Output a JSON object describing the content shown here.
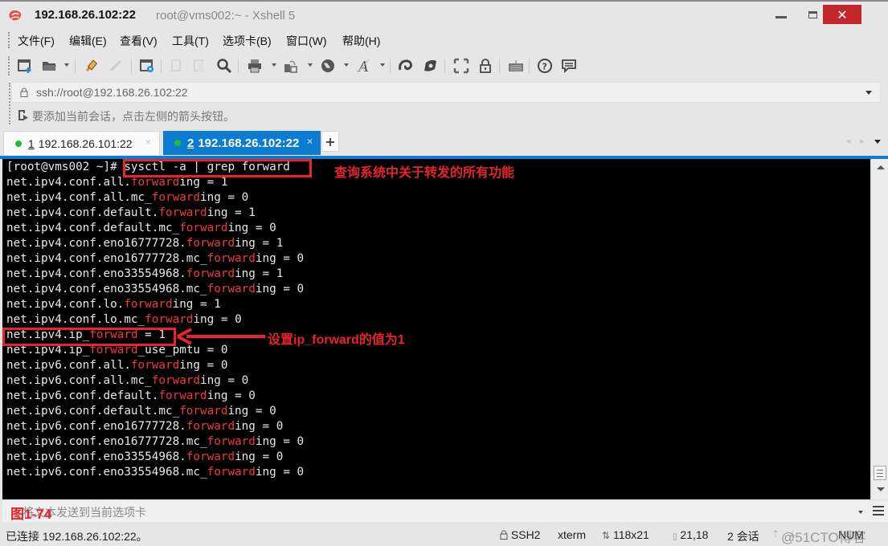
{
  "window": {
    "title_host": "192.168.26.102:22",
    "title_sub": "root@vms002:~ - Xshell 5",
    "close_glyph": "✕"
  },
  "menu": {
    "items": [
      {
        "label": "文件(F)"
      },
      {
        "label": "编辑(E)"
      },
      {
        "label": "查看(V)"
      },
      {
        "label": "工具(T)"
      },
      {
        "label": "选项卡(B)"
      },
      {
        "label": "窗口(W)"
      },
      {
        "label": "帮助(H)"
      }
    ]
  },
  "toolbar": {
    "icons": [
      "new-session-icon",
      "open-folder-icon",
      "connect-icon",
      "disconnect-icon",
      "session-properties-icon",
      "copy-icon",
      "paste-icon",
      "find-icon",
      "print-icon",
      "transfer-icon",
      "globe-icon",
      "font-icon",
      "xftp-icon",
      "xmanager-icon",
      "fullscreen-icon",
      "lock-icon",
      "keyboard-icon",
      "help-icon",
      "chat-icon"
    ]
  },
  "address": {
    "value": "ssh://root@192.168.26.102:22"
  },
  "hint": {
    "text": "要添加当前会话，点击左侧的箭头按钮。"
  },
  "tabs": [
    {
      "num": "1",
      "label": "192.168.26.101:22",
      "status_color": "#1fbf2c",
      "active": false
    },
    {
      "num": "2",
      "label": "192.168.26.102:22",
      "status_color": "#1fbf2c",
      "active": true
    }
  ],
  "tab_add_label": "+",
  "tab_close_glyph": "×",
  "tab_nav": "◂ ▸",
  "terminal": {
    "lines": [
      {
        "pre": "[root@vms002 ~]# sysctl -a | grep forward",
        "hl": "",
        "post": ""
      },
      {
        "pre": "net.ipv4.conf.all.",
        "hl": "forward",
        "post": "ing = 1"
      },
      {
        "pre": "net.ipv4.conf.all.mc_",
        "hl": "forward",
        "post": "ing = 0"
      },
      {
        "pre": "net.ipv4.conf.default.",
        "hl": "forward",
        "post": "ing = 1"
      },
      {
        "pre": "net.ipv4.conf.default.mc_",
        "hl": "forward",
        "post": "ing = 0"
      },
      {
        "pre": "net.ipv4.conf.eno16777728.",
        "hl": "forward",
        "post": "ing = 1"
      },
      {
        "pre": "net.ipv4.conf.eno16777728.mc_",
        "hl": "forward",
        "post": "ing = 0"
      },
      {
        "pre": "net.ipv4.conf.eno33554968.",
        "hl": "forward",
        "post": "ing = 1"
      },
      {
        "pre": "net.ipv4.conf.eno33554968.mc_",
        "hl": "forward",
        "post": "ing = 0"
      },
      {
        "pre": "net.ipv4.conf.lo.",
        "hl": "forward",
        "post": "ing = 1"
      },
      {
        "pre": "net.ipv4.conf.lo.mc_",
        "hl": "forward",
        "post": "ing = 0"
      },
      {
        "pre": "net.ipv4.ip_",
        "hl": "forward",
        "post": " = 1"
      },
      {
        "pre": "net.ipv4.ip_",
        "hl": "forward",
        "post": "_use_pmtu = 0"
      },
      {
        "pre": "net.ipv6.conf.all.",
        "hl": "forward",
        "post": "ing = 0"
      },
      {
        "pre": "net.ipv6.conf.all.mc_",
        "hl": "forward",
        "post": "ing = 0"
      },
      {
        "pre": "net.ipv6.conf.default.",
        "hl": "forward",
        "post": "ing = 0"
      },
      {
        "pre": "net.ipv6.conf.default.mc_",
        "hl": "forward",
        "post": "ing = 0"
      },
      {
        "pre": "net.ipv6.conf.eno16777728.",
        "hl": "forward",
        "post": "ing = 0"
      },
      {
        "pre": "net.ipv6.conf.eno16777728.mc_",
        "hl": "forward",
        "post": "ing = 0"
      },
      {
        "pre": "net.ipv6.conf.eno33554968.",
        "hl": "forward",
        "post": "ing = 0"
      },
      {
        "pre": "net.ipv6.conf.eno33554968.mc_",
        "hl": "forward",
        "post": "ing = 0"
      }
    ],
    "highlight_color": "#ee3a3a"
  },
  "annotations": {
    "command_note": "查询系统中关于转发的所有功能",
    "ip_forward_note": "设置ip_forward的值为1",
    "figure_label": "图1-74",
    "color": "#e8232a"
  },
  "compose": {
    "placeholder": "将文本发送到当前选项卡"
  },
  "status": {
    "connection": "已连接 192.168.26.102:22。",
    "protocol": "SSH2",
    "terminal_type": "xterm",
    "size": "118x21",
    "cursor": "21,18",
    "sessions": "2 会话",
    "arrows": "⇡ ⇣",
    "watermark": "@51CTO博客",
    "caps": "NUM"
  }
}
